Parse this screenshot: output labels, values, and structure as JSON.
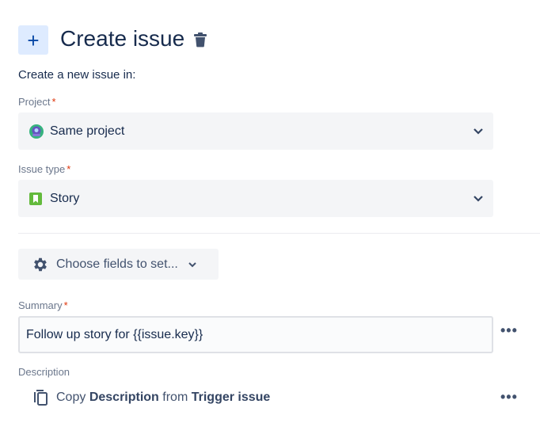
{
  "header": {
    "title": "Create issue",
    "add_icon": "plus-icon",
    "delete_icon": "trash-icon"
  },
  "intro": "Create a new issue in:",
  "project": {
    "label": "Project",
    "required": "*",
    "value": "Same project"
  },
  "issue_type": {
    "label": "Issue type",
    "required": "*",
    "value": "Story"
  },
  "choose_fields": {
    "label": "Choose fields to set..."
  },
  "summary": {
    "label": "Summary",
    "required": "*",
    "value": "Follow up story for {{issue.key}}",
    "more": "•••"
  },
  "description": {
    "label": "Description",
    "copy": "Copy",
    "field": "Description",
    "from": "from",
    "source": "Trigger issue",
    "more": "•••"
  },
  "colors": {
    "accent": "#0052cc",
    "required": "#de350b",
    "story": "#63ba3c"
  }
}
